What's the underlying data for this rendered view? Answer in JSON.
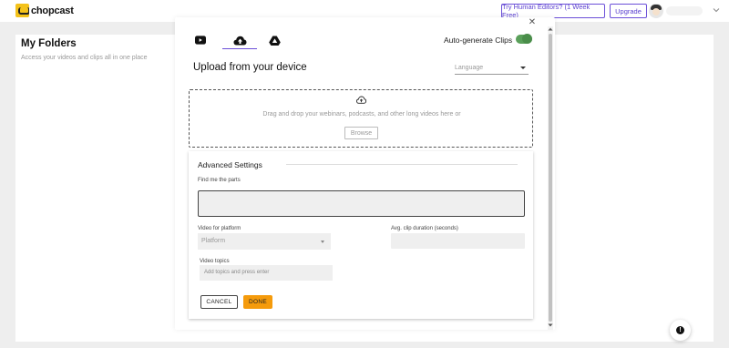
{
  "app": {
    "brand": "chopcast"
  },
  "header": {
    "try_label": "Try Human Editors? (1 Week Free)",
    "upgrade_label": "Upgrade"
  },
  "page": {
    "title": "My Folders",
    "subtitle": "Access your videos and clips all in one place"
  },
  "modal": {
    "close_symbol": "✕",
    "tabs": [
      {
        "icon": "youtube-icon",
        "active": false
      },
      {
        "icon": "cloud-upload-icon",
        "active": true
      },
      {
        "icon": "google-drive-icon",
        "active": false
      }
    ],
    "auto_generate_label": "Auto-generate Clips",
    "auto_generate_on": true,
    "upload_title": "Upload from your device",
    "language_placeholder": "Language",
    "drop_text": "Drag and drop your webinars, podcasts, and other long videos here or",
    "browse_label": "Browse",
    "advanced": {
      "title": "Advanced Settings",
      "find_label": "Find me the parts",
      "find_value": "",
      "platform_label": "Video for platform",
      "platform_placeholder": "Platform",
      "duration_label": "Avg. clip duration (seconds)",
      "duration_value": "",
      "topics_label": "Video topics",
      "topics_placeholder": "Add topics and press enter",
      "cancel_label": "CANCEL",
      "done_label": "DONE"
    }
  },
  "help": {
    "symbol": "!"
  },
  "colors": {
    "accent": "#6b4fd8",
    "toggle_on": "#4a8d4a",
    "done_button": "#f59b0c",
    "logo": "#f4c21a"
  }
}
